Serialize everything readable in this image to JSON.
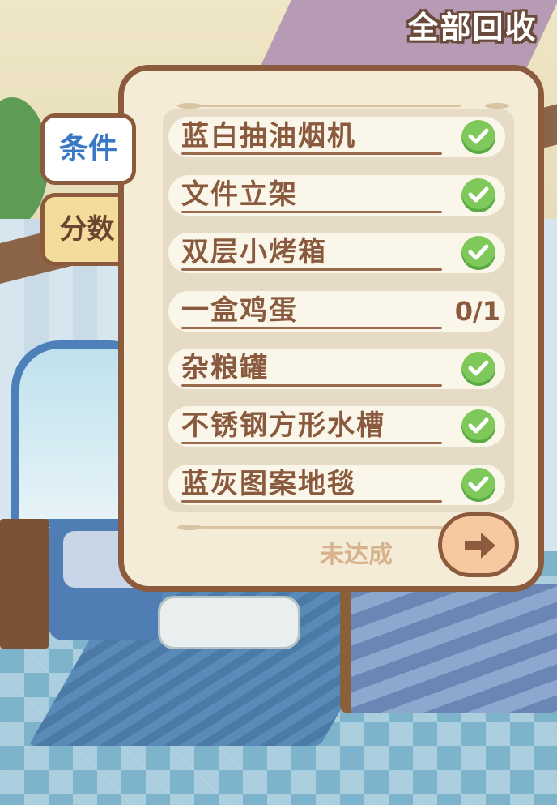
{
  "header": {
    "collect_all_label": "全部回收"
  },
  "tabs": [
    {
      "label": "条件",
      "active": true
    },
    {
      "label": "分数",
      "active": false
    }
  ],
  "requirements": [
    {
      "label": "蓝白抽油烟机",
      "completed": true,
      "icon": "check-icon"
    },
    {
      "label": "文件立架",
      "completed": true,
      "icon": "check-icon"
    },
    {
      "label": "双层小烤箱",
      "completed": true,
      "icon": "check-icon"
    },
    {
      "label": "一盒鸡蛋",
      "completed": false,
      "progress": "0/1"
    },
    {
      "label": "杂粮罐",
      "completed": true,
      "icon": "check-icon"
    },
    {
      "label": "不锈钢方形水槽",
      "completed": true,
      "icon": "check-icon"
    },
    {
      "label": "蓝灰图案地毯",
      "completed": true,
      "icon": "check-icon"
    }
  ],
  "footer": {
    "status_label": "未达成",
    "next_icon": "arrow-right-icon"
  },
  "colors": {
    "panel_border": "#8c5a3c",
    "panel_bg": "#f5ecd8",
    "check_green": "#7fc95a",
    "active_tab_text": "#3a78c4"
  }
}
